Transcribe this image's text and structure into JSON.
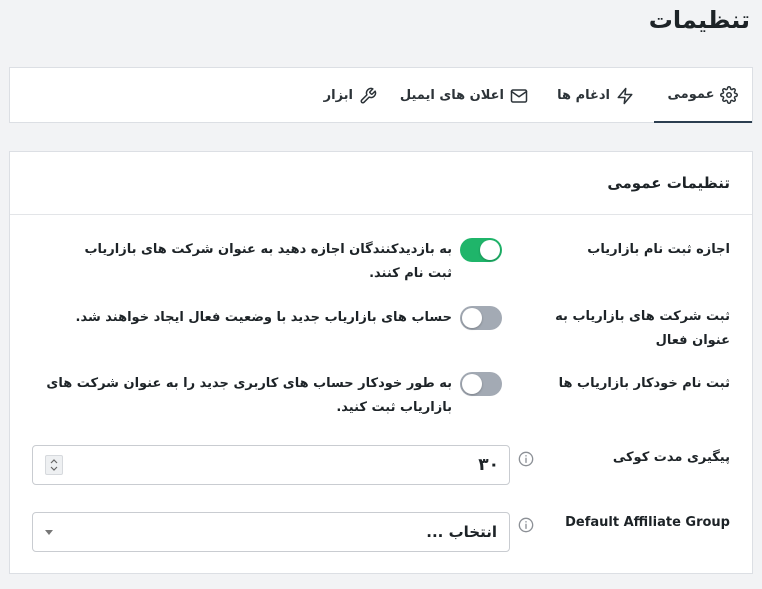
{
  "page": {
    "title": "تنظیمات"
  },
  "tabs": [
    {
      "label": "عمومی",
      "icon": "gear-icon",
      "active": true
    },
    {
      "label": "ادغام ها",
      "icon": "bolt-icon",
      "active": false
    },
    {
      "label": "اعلان های ایمیل",
      "icon": "envelope-icon",
      "active": false
    },
    {
      "label": "ابزار",
      "icon": "wrench-icon",
      "active": false
    }
  ],
  "section": {
    "title": "تنظیمات عمومی"
  },
  "settings": {
    "allow_registration": {
      "label": "اجازه ثبت نام بازاریاب",
      "description": "به بازدیدکنندگان اجازه دهید به عنوان شرکت های بازاریاب ثبت نام کنند.",
      "enabled": true
    },
    "register_active": {
      "label": "ثبت شرکت های بازاریاب به عنوان فعال",
      "description": "حساب های بازاریاب جدید با وضعیت فعال ایجاد خواهند شد.",
      "enabled": false
    },
    "auto_register": {
      "label": "ثبت نام خودکار بازاریاب ها",
      "description": "به طور خودکار حساب های کاربری جدید را به عنوان شرکت های بازاریاب ثبت کنید.",
      "enabled": false
    },
    "cookie_duration": {
      "label": "پیگیری مدت کوکی",
      "value": "۳۰"
    },
    "default_group": {
      "label": "Default Affiliate Group",
      "selected": "انتخاب ..."
    }
  },
  "colors": {
    "toggle_on": "#1fb56a",
    "toggle_off": "#a3aab4",
    "active_tab_underline": "#2c3e50"
  }
}
